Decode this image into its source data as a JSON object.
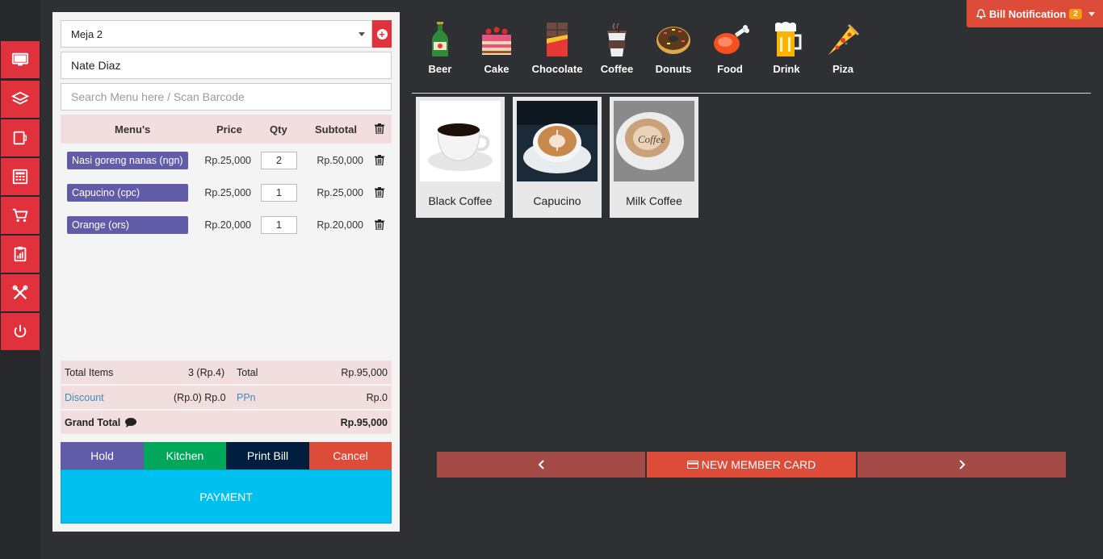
{
  "nav": [
    "monitor-icon",
    "layers-icon",
    "tablet-icon",
    "calculator-icon",
    "cart-icon",
    "report-icon",
    "tools-icon",
    "power-icon"
  ],
  "order": {
    "table": "Meja 2",
    "customer": "Nate Diaz",
    "search_placeholder": "Search Menu here / Scan Barcode",
    "headers": {
      "menu": "Menu's",
      "price": "Price",
      "qty": "Qty",
      "subtotal": "Subtotal"
    },
    "items": [
      {
        "name": "Nasi goreng nanas (ngn)",
        "price": "Rp.25,000",
        "qty": "2",
        "subtotal": "Rp.50,000"
      },
      {
        "name": "Capucino (cpc)",
        "price": "Rp.25,000",
        "qty": "1",
        "subtotal": "Rp.25,000"
      },
      {
        "name": "Orange (ors)",
        "price": "Rp.20,000",
        "qty": "1",
        "subtotal": "Rp.20,000"
      }
    ]
  },
  "summary": {
    "total_items_label": "Total Items",
    "total_items_value": "3 (Rp.4)",
    "total_label": "Total",
    "total_value": "Rp.95,000",
    "discount_label": "Discount",
    "discount_value": "(Rp.0) Rp.0",
    "ppn_label": "PPn",
    "ppn_value": "Rp.0",
    "grand_total_label": "Grand Total",
    "grand_total_value": "Rp.95,000"
  },
  "actions": {
    "hold": "Hold",
    "kitchen": "Kitchen",
    "print_bill": "Print Bill",
    "cancel": "Cancel",
    "payment": "PAYMENT"
  },
  "colors": {
    "hold": "#605ca8",
    "kitchen": "#00a65a",
    "print_bill": "#001f3f",
    "cancel": "#dd4b39",
    "payment": "#00c0ef",
    "nav": "#e0313d"
  },
  "notification": {
    "label": "Bill Notification",
    "count": "2"
  },
  "categories": [
    {
      "label": "Beer",
      "icon": "beer-icon"
    },
    {
      "label": "Cake",
      "icon": "cake-icon"
    },
    {
      "label": "Chocolate",
      "icon": "chocolate-icon"
    },
    {
      "label": "Coffee",
      "icon": "coffee-icon"
    },
    {
      "label": "Donuts",
      "icon": "donuts-icon"
    },
    {
      "label": "Food",
      "icon": "food-icon"
    },
    {
      "label": "Drink",
      "icon": "drink-icon"
    },
    {
      "label": "Piza",
      "icon": "pizza-icon"
    }
  ],
  "products": [
    {
      "name": "Black Coffee"
    },
    {
      "name": "Capucino"
    },
    {
      "name": "Milk Coffee"
    }
  ],
  "pager": {
    "new_member_card": "NEW MEMBER CARD"
  }
}
